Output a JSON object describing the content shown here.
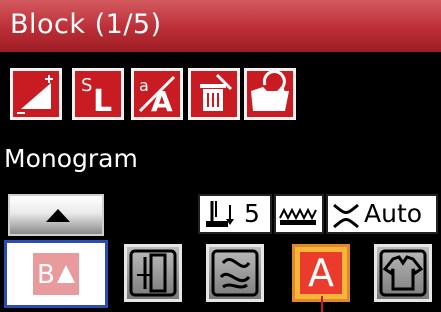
{
  "header": {
    "title": "Block (1/5)"
  },
  "toolbar": {
    "buttons": [
      {
        "name": "edit-size-button",
        "icon": "size-wedge-plus-minus-icon"
      },
      {
        "name": "sl-button",
        "icon": "s-l-icon"
      },
      {
        "name": "text-clear-button",
        "icon": "a-cross-icon"
      },
      {
        "name": "delete-button",
        "icon": "trash-icon"
      },
      {
        "name": "save-button",
        "icon": "folder-save-icon"
      }
    ]
  },
  "mode_label": "Monogram",
  "controls": {
    "up_button_icon": "triangle-up-icon",
    "presser_foot_value": "5",
    "feed_icon": "feed-dogs-icon",
    "tension_label": "Auto"
  },
  "categories": [
    {
      "name": "block-letter-tile",
      "icon": "b-triangle-icon",
      "active": true
    },
    {
      "name": "utility-stitch-tile",
      "icon": "straight-stitch-icon"
    },
    {
      "name": "decorative-stitch-tile",
      "icon": "decorative-pattern-icon"
    },
    {
      "name": "monogram-tile",
      "icon": "letter-a-icon",
      "letter": "A",
      "selected": true
    },
    {
      "name": "garment-tile",
      "icon": "shirt-icon"
    }
  ]
}
